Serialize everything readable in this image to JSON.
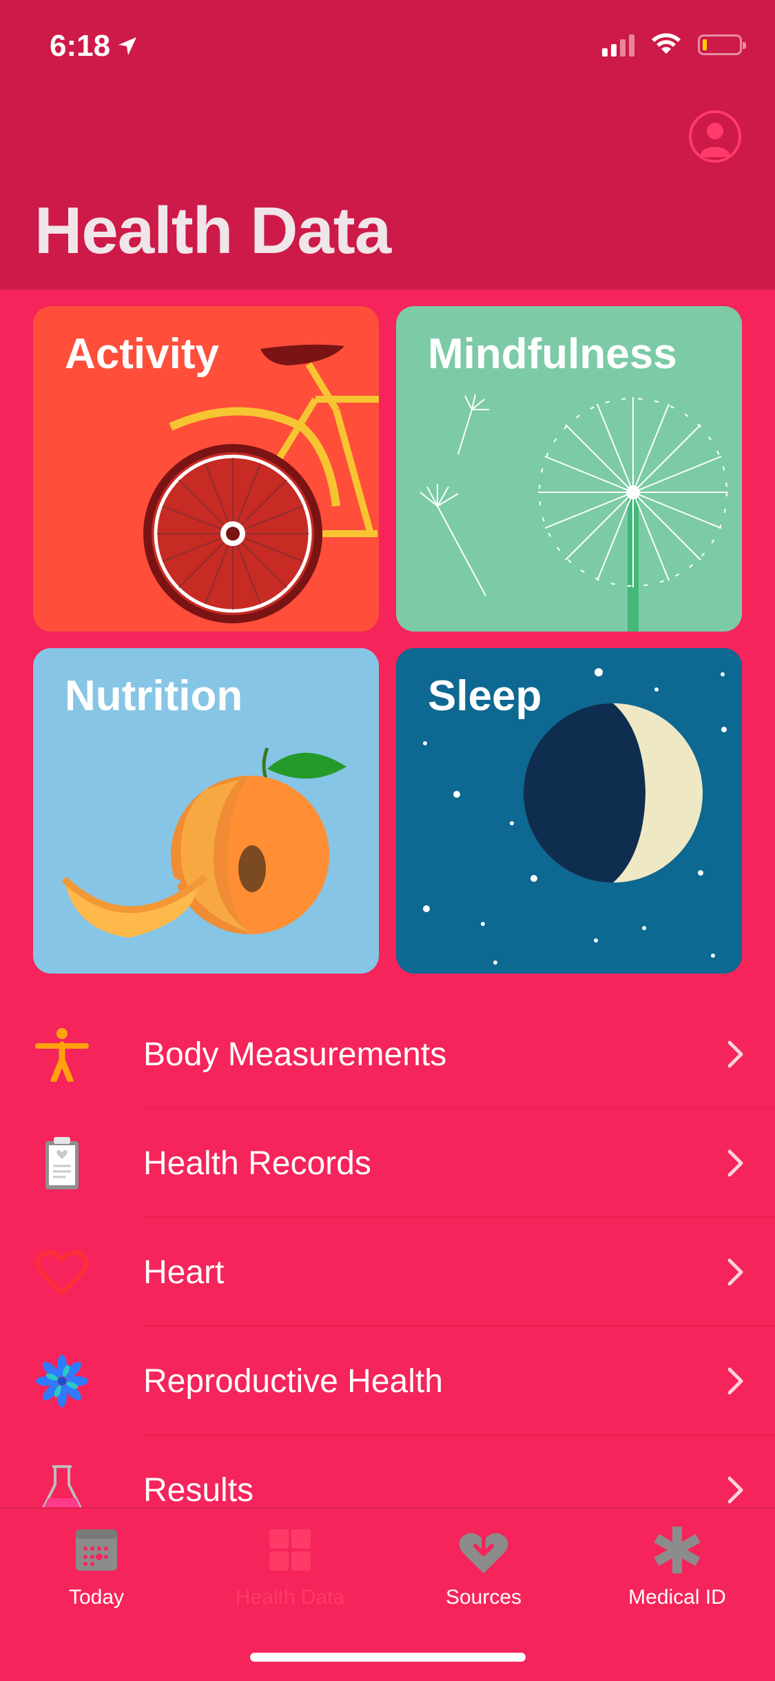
{
  "status": {
    "time": "6:18"
  },
  "header": {
    "title": "Health Data"
  },
  "tiles": [
    {
      "label": "Activity"
    },
    {
      "label": "Mindfulness"
    },
    {
      "label": "Nutrition"
    },
    {
      "label": "Sleep"
    }
  ],
  "list": [
    {
      "label": "Body Measurements",
      "icon": "body-figure-icon"
    },
    {
      "label": "Health Records",
      "icon": "clipboard-icon"
    },
    {
      "label": "Heart",
      "icon": "heart-icon"
    },
    {
      "label": "Reproductive Health",
      "icon": "flower-icon"
    },
    {
      "label": "Results",
      "icon": "flask-icon"
    }
  ],
  "tabbar": [
    {
      "label": "Today",
      "icon": "calendar-icon"
    },
    {
      "label": "Health Data",
      "icon": "grid-icon",
      "active": true
    },
    {
      "label": "Sources",
      "icon": "heart-download-icon"
    },
    {
      "label": "Medical ID",
      "icon": "asterisk-icon"
    }
  ],
  "colors": {
    "header": "#cd1a48",
    "background": "#f5245b",
    "accent": "#ff3a66"
  }
}
